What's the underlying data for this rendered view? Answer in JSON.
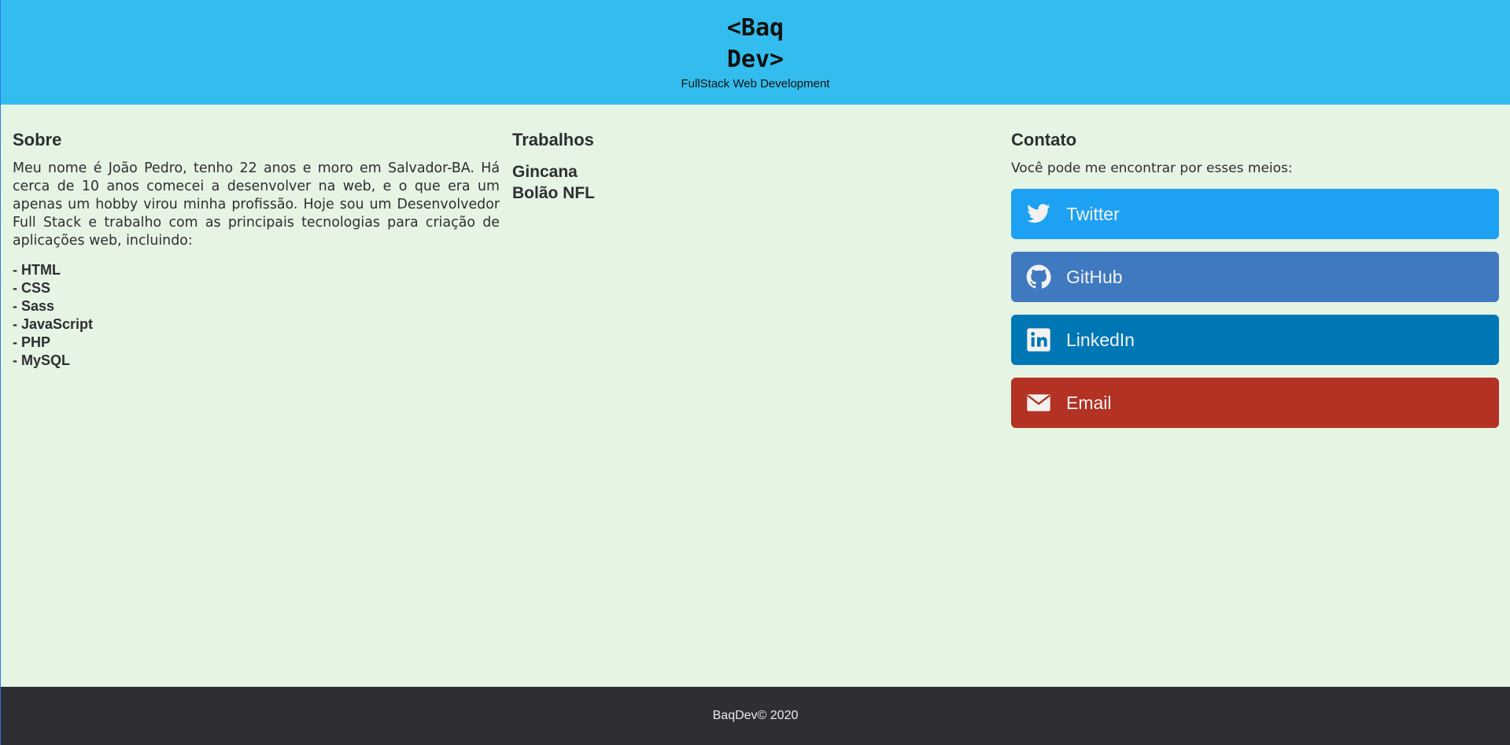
{
  "header": {
    "logo_line1": "<Baq",
    "logo_line2": "Dev>",
    "tagline": "FullStack Web Development",
    "bg_color": "#33bdee"
  },
  "sobre": {
    "title": "Sobre",
    "text": "Meu nome é João Pedro, tenho 22 anos e moro em Salvador-BA. Há cerca de 10 anos comecei a desenvolver na web, e o que era um apenas um hobby virou minha profissão. Hoje sou um Desenvolvedor Full Stack e trabalho com as principais tecnologias para criação de aplicações web, incluindo:",
    "skills": [
      "- HTML",
      "- CSS",
      "- Sass",
      "- JavaScript",
      "- PHP",
      "- MySQL"
    ]
  },
  "trabalhos": {
    "title": "Trabalhos",
    "items": [
      "Gincana",
      "Bolão NFL"
    ]
  },
  "contato": {
    "title": "Contato",
    "intro": "Você pode me encontrar por esses meios:",
    "buttons": [
      {
        "label": "Twitter",
        "icon": "twitter-icon",
        "color": "#1da1f2"
      },
      {
        "label": "GitHub",
        "icon": "github-icon",
        "color": "#3f79c0"
      },
      {
        "label": "LinkedIn",
        "icon": "linkedin-icon",
        "color": "#0077b5"
      },
      {
        "label": "Email",
        "icon": "envelope-icon",
        "color": "#b33223"
      }
    ]
  },
  "footer": {
    "text": "BaqDev© 2020"
  }
}
